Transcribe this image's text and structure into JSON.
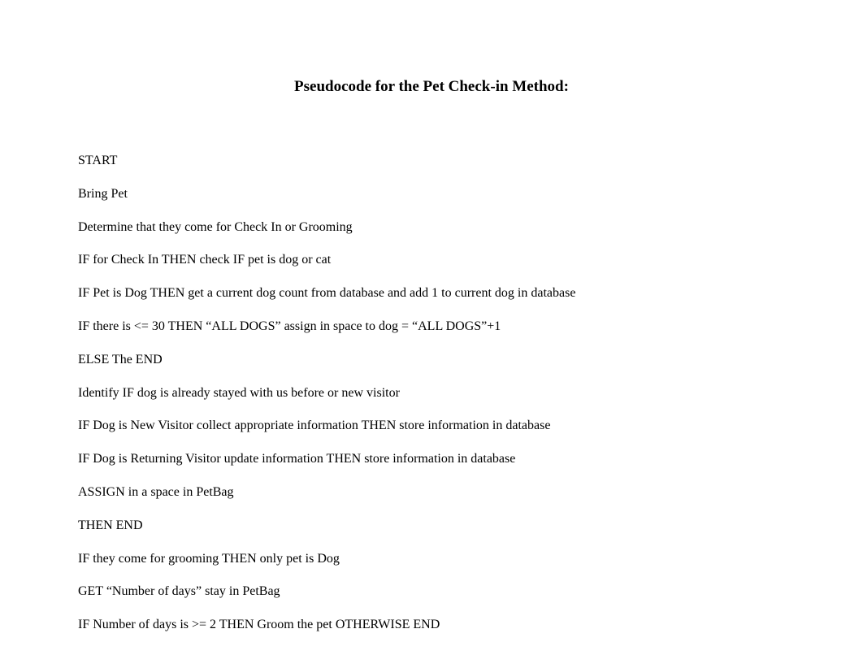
{
  "title": "Pseudocode for the Pet Check-in Method:",
  "lines": [
    "START",
    "Bring Pet",
    "Determine that they come for Check In or Grooming",
    "IF for Check In THEN check IF pet is dog or cat",
    "IF Pet is Dog THEN get a current dog count from database and add 1 to current dog in database",
    "IF there is <= 30 THEN “ALL DOGS” assign in space to dog = “ALL DOGS”+1",
    "ELSE The END",
    "Identify IF dog is already stayed with us before or new visitor",
    "IF Dog is New Visitor collect appropriate information THEN store information in database",
    "IF Dog is Returning Visitor update information THEN store information in database",
    "ASSIGN in a space in PetBag",
    "THEN END",
    "IF they come for grooming THEN only pet is Dog",
    "GET “Number of days” stay in PetBag",
    "IF Number of days is >= 2 THEN Groom the pet OTHERWISE END"
  ]
}
